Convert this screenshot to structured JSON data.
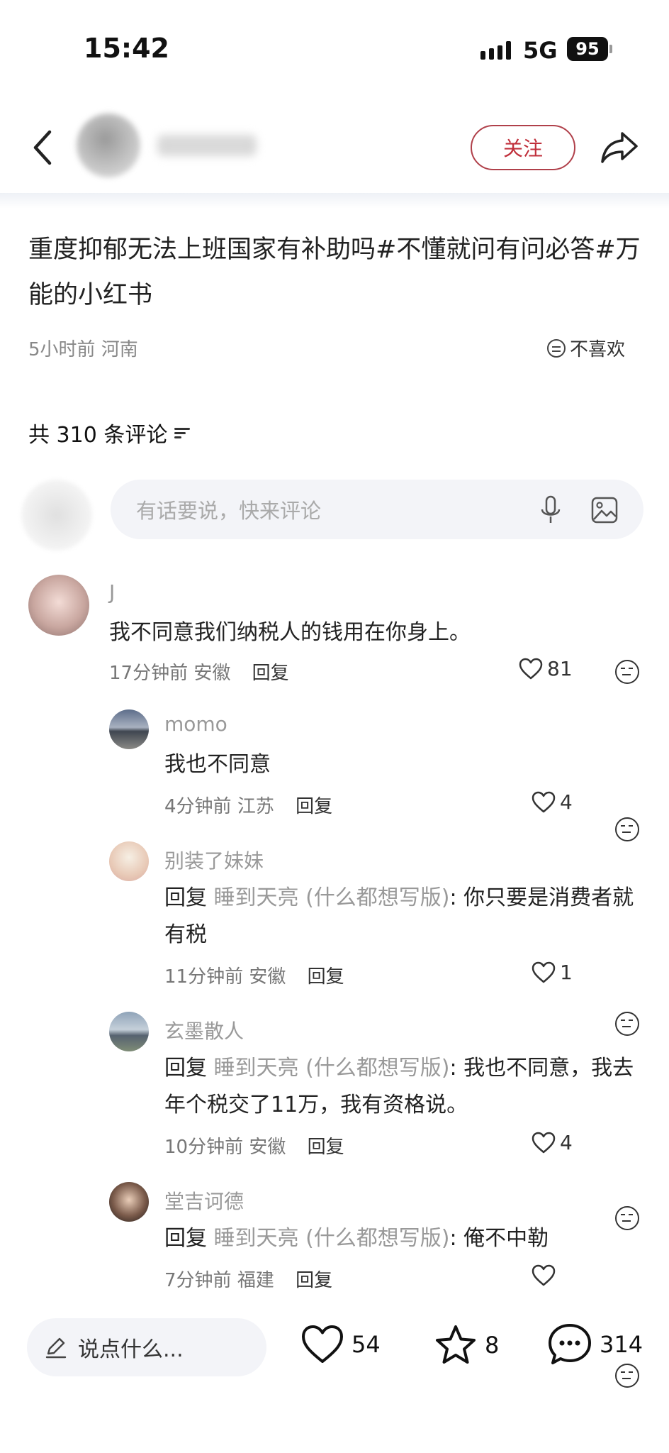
{
  "status": {
    "time": "15:42",
    "network": "5G",
    "battery": "95"
  },
  "nav": {
    "follow_label": "关注"
  },
  "post": {
    "title": "重度抑郁无法上班国家有补助吗#不懂就问有问必答#万能的小红书",
    "meta": "5小时前 河南",
    "dislike_label": "不喜欢"
  },
  "comments_header": {
    "count_label": "共 310 条评论"
  },
  "comment_input": {
    "placeholder": "有话要说，快来评论"
  },
  "comments": [
    {
      "user": "J",
      "text": "我不同意我们纳税人的钱用在你身上。",
      "time": "17分钟前",
      "location": "安徽",
      "reply_label": "回复",
      "likes": "81"
    },
    {
      "user": "momo",
      "text": "我也不同意",
      "time": "4分钟前",
      "location": "江苏",
      "reply_label": "回复",
      "likes": "4"
    },
    {
      "user": "别装了妹妹",
      "reply_prefix": "回复",
      "reply_to": "睡到天亮 (什么都想写版)",
      "text": ": 你只要是消费者就有税",
      "time": "11分钟前",
      "location": "安徽",
      "reply_label": "回复",
      "likes": "1"
    },
    {
      "user": "玄墨散人",
      "reply_prefix": "回复",
      "reply_to": "睡到天亮 (什么都想写版)",
      "text": ": 我也不同意，我去年个税交了11万，我有资格说。",
      "time": "10分钟前",
      "location": "安徽",
      "reply_label": "回复",
      "likes": "4"
    },
    {
      "user": "堂吉诃德",
      "reply_prefix": "回复",
      "reply_to": "睡到天亮 (什么都想写版)",
      "text": ": 俺不中勒",
      "time": "7分钟前",
      "location": "福建",
      "reply_label": "回复",
      "likes": ""
    }
  ],
  "bottom_bar": {
    "input_label": "说点什么...",
    "likes": "54",
    "favorites": "8",
    "comments": "314"
  },
  "icons": [
    "back-icon",
    "share-icon",
    "mic-icon",
    "image-icon",
    "heart-icon",
    "star-icon",
    "chat-bubble-icon",
    "pencil-icon",
    "dislike-face-icon",
    "sort-icon"
  ]
}
